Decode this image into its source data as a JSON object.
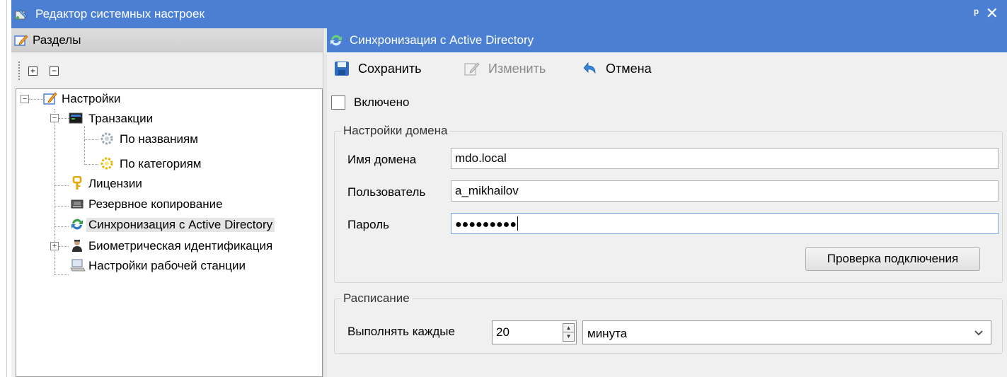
{
  "window": {
    "title": "Редактор системных настроек",
    "pin_glyph": "ᵖ",
    "close_glyph": "✕"
  },
  "left_panel": {
    "title": "Разделы",
    "toolbar": {
      "expand_all": "+",
      "collapse_all": "−"
    },
    "tree": [
      {
        "label": "Настройки",
        "icon": "settings-icon",
        "expanded": true
      },
      {
        "label": "Транзакции",
        "icon": "terminal-icon",
        "expanded": true
      },
      {
        "label": "По названиям",
        "icon": "gear-gray-icon"
      },
      {
        "label": "По категориям",
        "icon": "gear-yellow-icon"
      },
      {
        "label": "Лицензии",
        "icon": "key-icon"
      },
      {
        "label": "Резервное копирование",
        "icon": "backup-icon"
      },
      {
        "label": "Синхронизация с Active Directory",
        "icon": "sync-icon",
        "selected": true
      },
      {
        "label": "Биометрическая идентификация",
        "icon": "person-icon",
        "expanded": false
      },
      {
        "label": "Настройки рабочей станции",
        "icon": "workstation-icon"
      }
    ]
  },
  "right_panel": {
    "title": "Синхронизация с Active Directory",
    "toolbar": {
      "save": "Сохранить",
      "edit": "Изменить",
      "cancel": "Отмена"
    },
    "enabled": {
      "label": "Включено",
      "checked": false
    },
    "domain_group": {
      "title": "Настройки домена",
      "domain_label": "Имя домена",
      "domain_value": "mdo.local",
      "user_label": "Пользователь",
      "user_value": "a_mikhailov",
      "password_label": "Пароль",
      "password_value": "●●●●●●●●●",
      "test_button": "Проверка подключения"
    },
    "schedule_group": {
      "title": "Расписание",
      "run_every_label": "Выполнять каждые",
      "interval_value": "20",
      "unit_value": "минута"
    }
  },
  "colors": {
    "title_bar": "#4a7fd4",
    "panel_bg": "#f0f0f0",
    "selection": "#e5e5e5"
  }
}
